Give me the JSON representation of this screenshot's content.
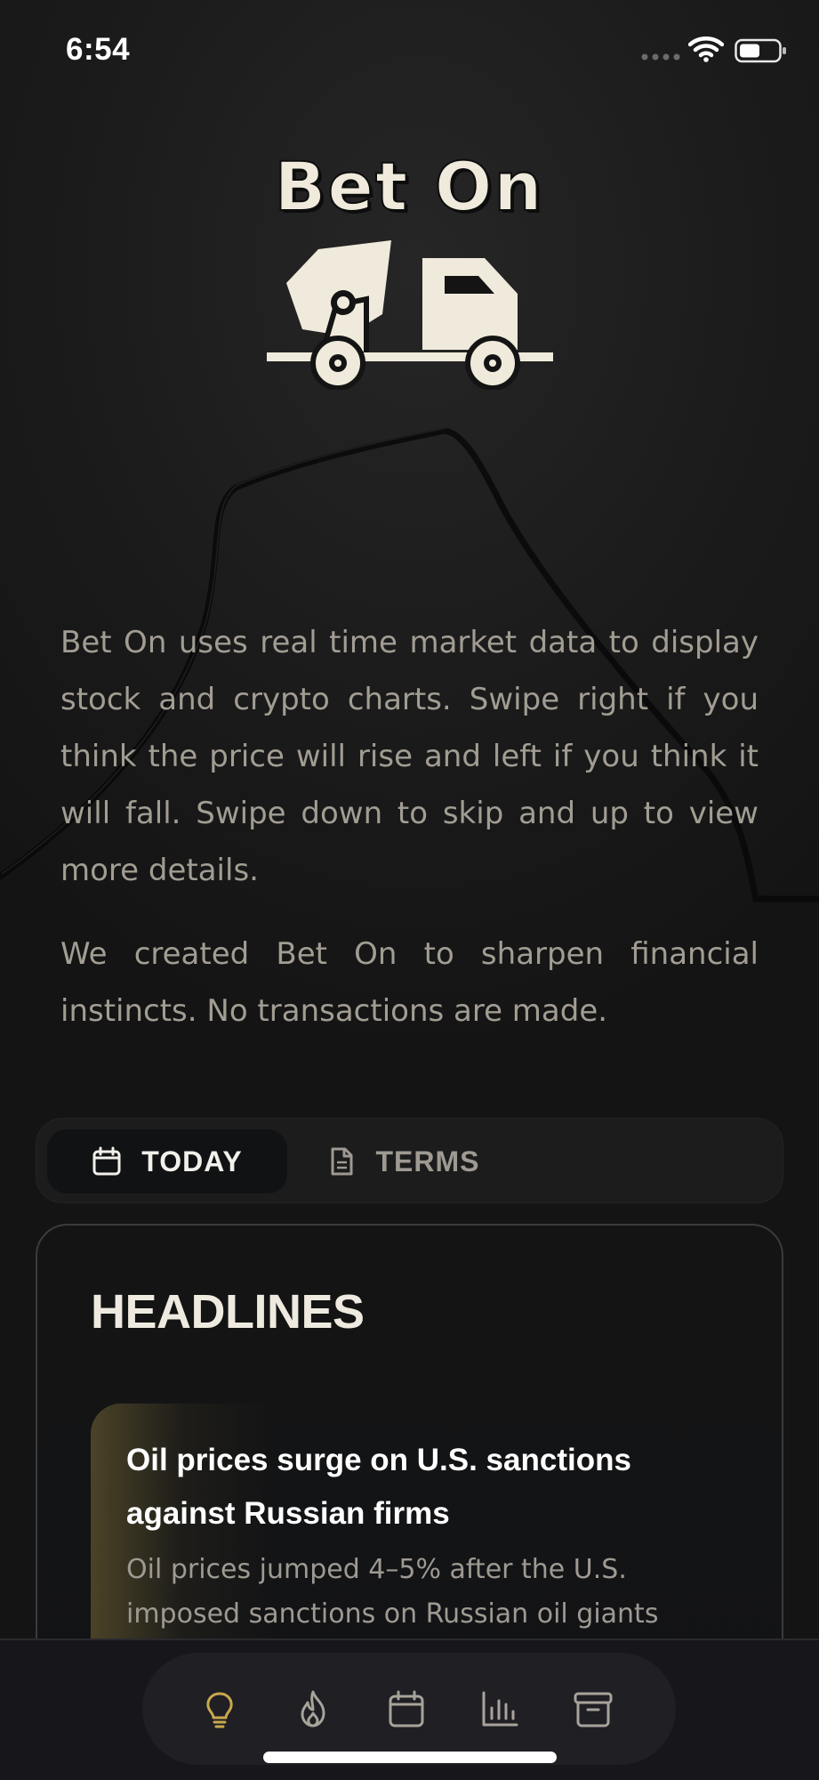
{
  "status_bar": {
    "time": "6:54"
  },
  "logo": {
    "title": "Bet On",
    "icon": "cement-mixer-truck-icon",
    "color": "#efeadb"
  },
  "description": {
    "paragraph1": "Bet On uses real time market data to display stock and crypto charts. Swipe right if you think the price will rise and left if you think it will fall. Swipe down to skip and up to view more details.",
    "paragraph2": "We created Bet On to sharpen financial instincts. No transactions are made."
  },
  "tabs": [
    {
      "label": "TODAY",
      "icon": "calendar-icon",
      "selected": true
    },
    {
      "label": "TERMS",
      "icon": "document-icon",
      "selected": false
    }
  ],
  "headlines": {
    "title": "HEADLINES",
    "items": [
      {
        "title": "Oil prices surge on U.S. sanctions against Russian firms",
        "summary": "Oil prices jumped 4–5% after the U.S. imposed sanctions on Russian oil giants"
      }
    ]
  },
  "bottom_nav": [
    {
      "icon": "lightbulb-icon",
      "active": true
    },
    {
      "icon": "flame-icon",
      "active": false
    },
    {
      "icon": "calendar-icon",
      "active": false
    },
    {
      "icon": "bar-chart-icon",
      "active": false
    },
    {
      "icon": "archive-icon",
      "active": false
    }
  ],
  "colors": {
    "background": "#161616",
    "accent_gold": "#c9a84c",
    "text_primary": "#eeeae0",
    "text_secondary": "#a29d93"
  }
}
